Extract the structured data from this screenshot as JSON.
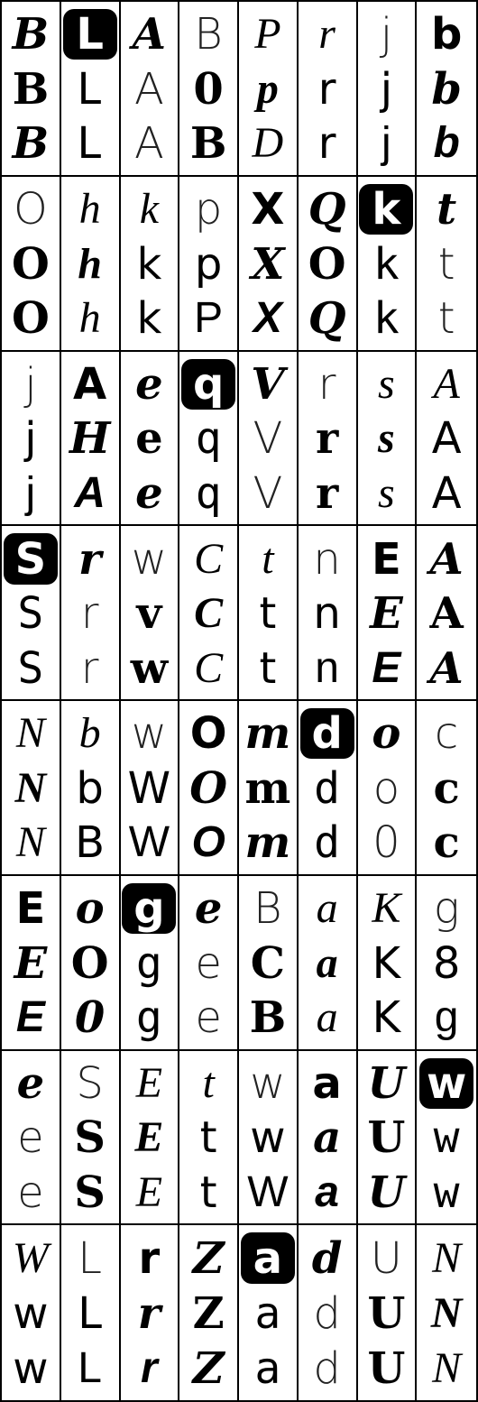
{
  "grid": {
    "rows": 8,
    "cols": 8,
    "cells": [
      [
        "B",
        "B",
        "B"
      ],
      [
        "L",
        "L",
        "L"
      ],
      [
        "A",
        "A",
        "A"
      ],
      [
        "B",
        "0",
        "B"
      ],
      [
        "P",
        "p",
        "D"
      ],
      [
        "r",
        "r",
        "r"
      ],
      [
        "j",
        "j",
        "j"
      ],
      [
        "b",
        "b",
        "b"
      ],
      [
        "O",
        "O",
        "O"
      ],
      [
        "h",
        "h",
        "h"
      ],
      [
        "k",
        "k",
        "k"
      ],
      [
        "p",
        "p",
        "P"
      ],
      [
        "X",
        "X",
        "X"
      ],
      [
        "Q",
        "O",
        "Q"
      ],
      [
        "k",
        "k",
        "k"
      ],
      [
        "t",
        "t",
        "t"
      ],
      [
        "j",
        "j",
        "j"
      ],
      [
        "A",
        "H",
        "A"
      ],
      [
        "e",
        "e",
        "e"
      ],
      [
        "q",
        "q",
        "q"
      ],
      [
        "V",
        "V",
        "V"
      ],
      [
        "r",
        "r",
        "r"
      ],
      [
        "s",
        "s",
        "s"
      ],
      [
        "A",
        "A",
        "A"
      ],
      [
        "S",
        "S",
        "S"
      ],
      [
        "r",
        "r",
        "r"
      ],
      [
        "w",
        "v",
        "w"
      ],
      [
        "C",
        "C",
        "C"
      ],
      [
        "t",
        "t",
        "t"
      ],
      [
        "n",
        "n",
        "n"
      ],
      [
        "E",
        "E",
        "E"
      ],
      [
        "A",
        "A",
        "A"
      ],
      [
        "N",
        "N",
        "N"
      ],
      [
        "b",
        "b",
        "B"
      ],
      [
        "w",
        "W",
        "W"
      ],
      [
        "O",
        "O",
        "O"
      ],
      [
        "m",
        "m",
        "m"
      ],
      [
        "d",
        "d",
        "d"
      ],
      [
        "o",
        "o",
        "0"
      ],
      [
        "c",
        "c",
        "c"
      ],
      [
        "E",
        "E",
        "E"
      ],
      [
        "o",
        "O",
        "0"
      ],
      [
        "g",
        "g",
        "g"
      ],
      [
        "e",
        "e",
        "e"
      ],
      [
        "B",
        "C",
        "B"
      ],
      [
        "a",
        "a",
        "a"
      ],
      [
        "K",
        "K",
        "K"
      ],
      [
        "g",
        "8",
        "g"
      ],
      [
        "e",
        "e",
        "e"
      ],
      [
        "S",
        "S",
        "S"
      ],
      [
        "E",
        "E",
        "E"
      ],
      [
        "t",
        "t",
        "t"
      ],
      [
        "w",
        "w",
        "W"
      ],
      [
        "a",
        "a",
        "a"
      ],
      [
        "U",
        "U",
        "U"
      ],
      [
        "w",
        "w",
        "w"
      ],
      [
        "W",
        "w",
        "w"
      ],
      [
        "L",
        "L",
        "L"
      ],
      [
        "r",
        "r",
        "r"
      ],
      [
        "Z",
        "Z",
        "Z"
      ],
      [
        "a",
        "a",
        "a"
      ],
      [
        "d",
        "d",
        "d"
      ],
      [
        "U",
        "U",
        "U"
      ],
      [
        "N",
        "N",
        "N"
      ]
    ]
  }
}
